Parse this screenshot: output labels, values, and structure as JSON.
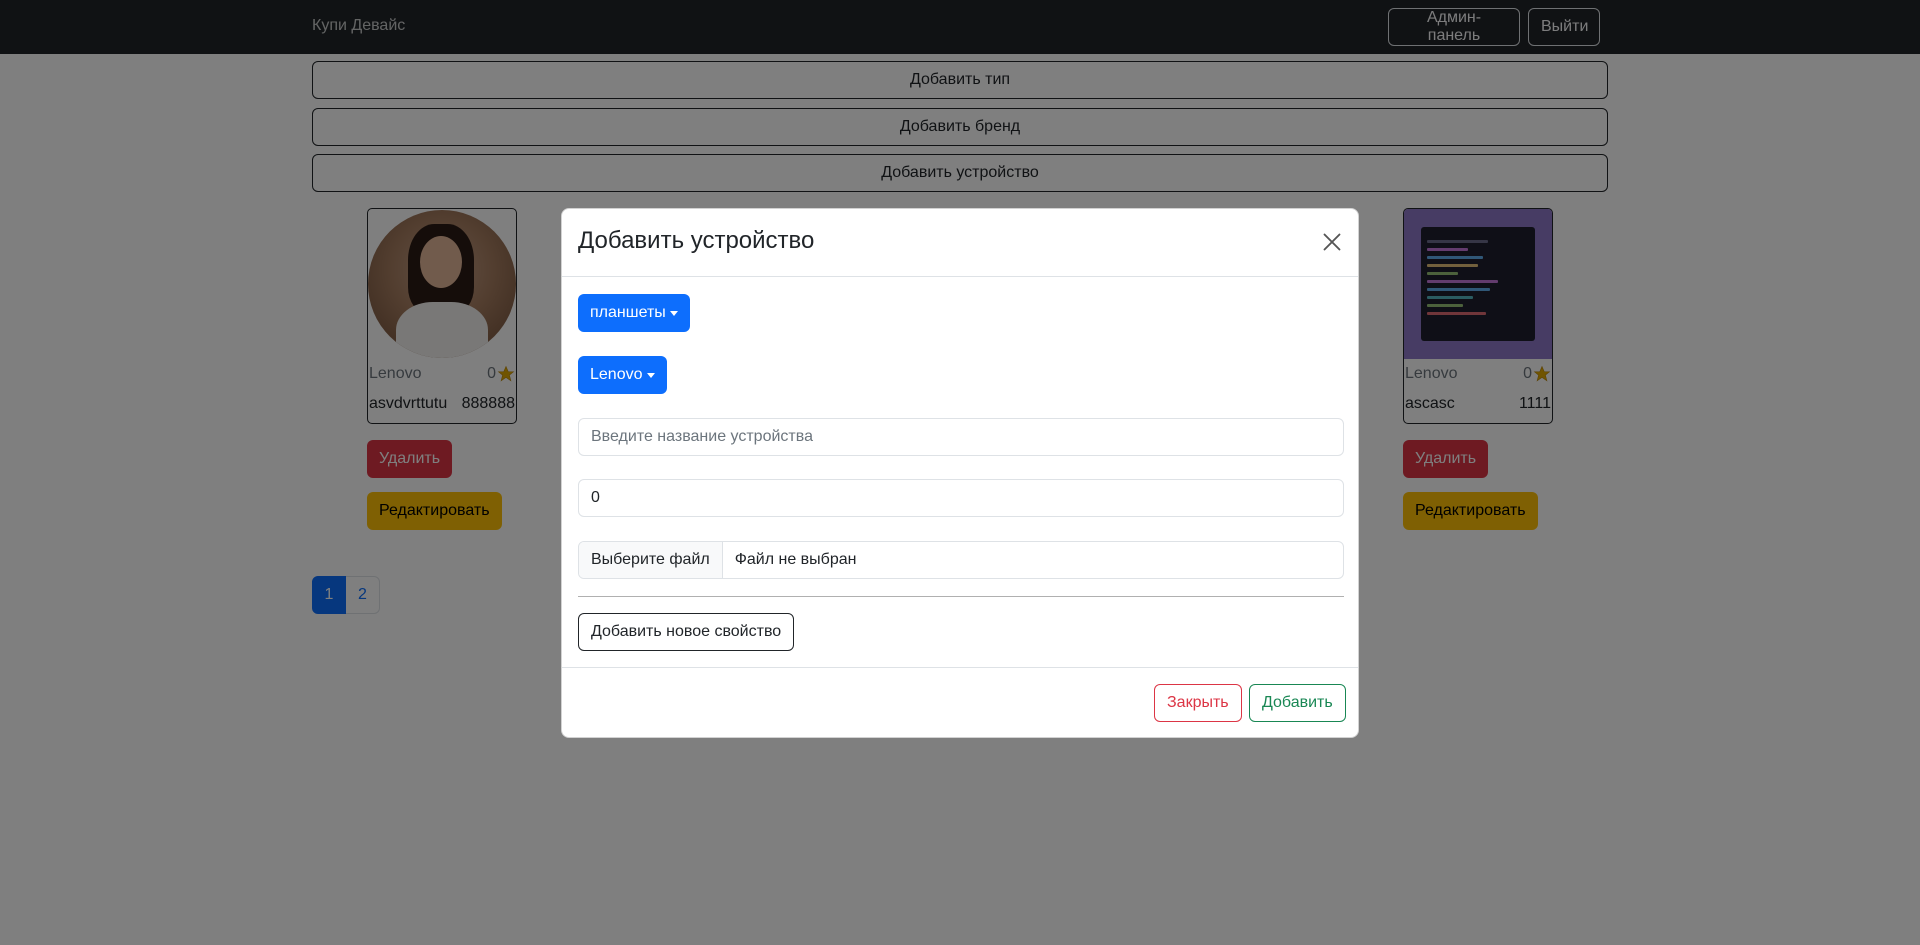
{
  "navbar": {
    "brand": "Купи Девайс",
    "admin_label": "Админ-панель",
    "logout_label": "Выйти"
  },
  "admin_actions": {
    "add_type": "Добавить тип",
    "add_brand": "Добавить бренд",
    "add_device": "Добавить устройство"
  },
  "devices": [
    {
      "brand": "Lenovo",
      "rating": "0",
      "name": "asvdvrttutu",
      "price": "888888",
      "delete_label": "Удалить",
      "edit_label": "Редактировать"
    },
    {
      "brand": "Lenovo",
      "rating": "0",
      "name": "ascasc",
      "price": "1111",
      "delete_label": "Удалить",
      "edit_label": "Редактировать"
    }
  ],
  "pagination": {
    "pages": [
      "1",
      "2"
    ],
    "active": "1"
  },
  "modal": {
    "title": "Добавить устройство",
    "type_dropdown": "планшеты",
    "brand_dropdown": "Lenovo",
    "name_placeholder": "Введите название устройства",
    "price_value": "0",
    "file_button": "Выберите файл",
    "file_status": "Файл не выбран",
    "add_property": "Добавить новое свойство",
    "close_label": "Закрыть",
    "submit_label": "Добавить"
  },
  "colors": {
    "primary": "#0d6efd",
    "danger": "#dc3545",
    "warning": "#ffc107",
    "success": "#198754",
    "navbar": "#212529"
  },
  "icons": {
    "close": "close-icon",
    "star": "star-icon",
    "caret": "caret-down-icon"
  }
}
